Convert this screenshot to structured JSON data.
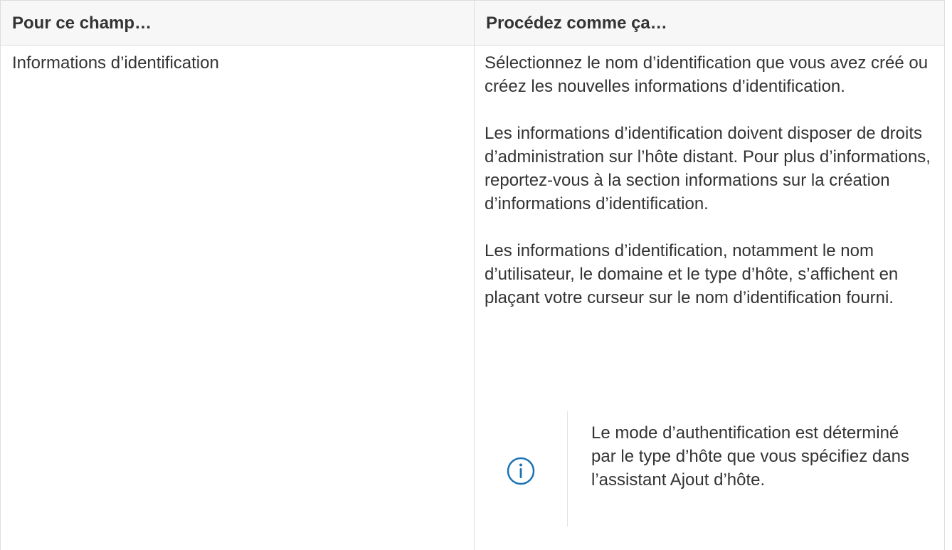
{
  "table": {
    "header": {
      "col1": "Pour ce champ…",
      "col2": "Procédez comme ça…"
    },
    "row": {
      "field": "Informations d’identification",
      "paragraphs": [
        "Sélectionnez le nom d’identification que vous avez créé ou créez les nouvelles informations d’identification.",
        "Les informations d’identification doivent disposer de droits d’administration sur l’hôte distant. Pour plus d’informations, reportez-vous à la section informations sur la création d’informations d’identification.",
        "Les informations d’identification, notamment le nom d’utilisateur, le domaine et le type d’hôte, s’affichent en plaçant votre curseur sur le nom d’identification fourni."
      ],
      "note": {
        "icon": "info-icon",
        "text": "Le mode d’authentification est déterminé par le type d’hôte que vous spécifiez dans l’assistant Ajout d’hôte."
      }
    }
  },
  "colors": {
    "text": "#333333",
    "header_bg": "#f7f7f7",
    "border": "#dddddd",
    "info_icon": "#1a73b5"
  }
}
